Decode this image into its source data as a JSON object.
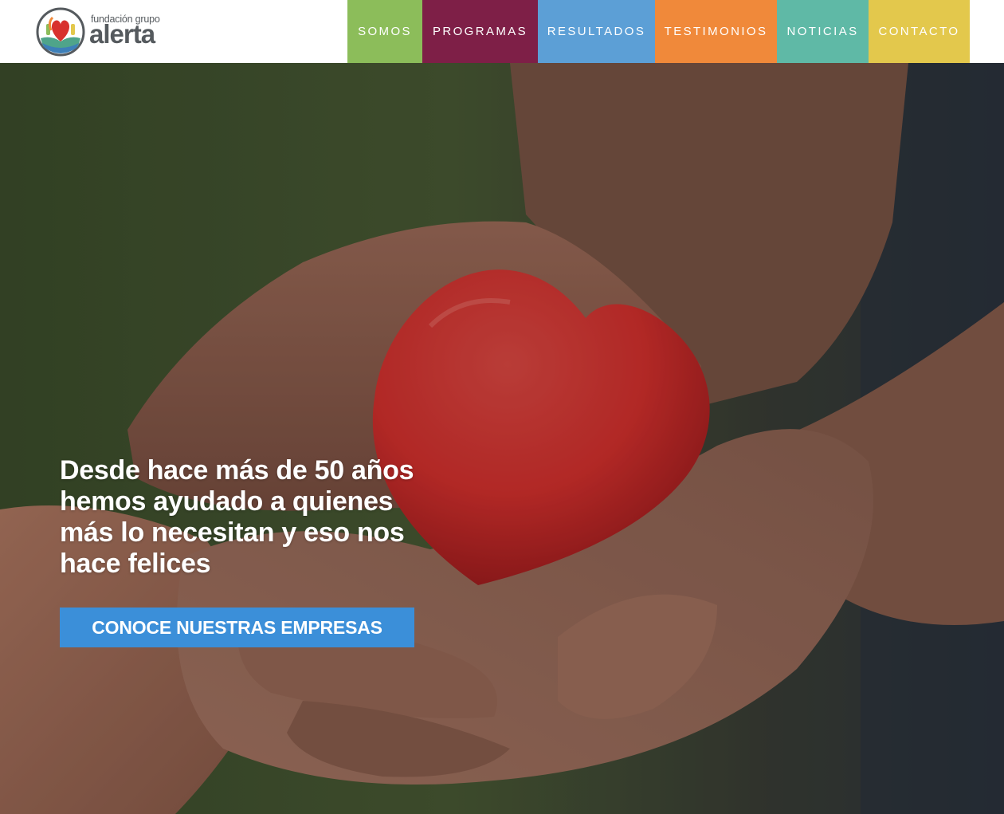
{
  "header": {
    "logo": {
      "line1": "fundación grupo",
      "line2": "alerta"
    },
    "nav": [
      {
        "label": "SOMOS",
        "color": "#8cbd5a"
      },
      {
        "label": "PROGRAMAS",
        "color": "#7e1f47"
      },
      {
        "label": "RESULTADOS",
        "color": "#5c9fd6"
      },
      {
        "label": "TESTIMONIOS",
        "color": "#f0893a"
      },
      {
        "label": "NOTICIAS",
        "color": "#5fb9a6"
      },
      {
        "label": "CONTACTO",
        "color": "#e3c84c"
      }
    ]
  },
  "hero": {
    "image": "hands-holding-red-heart-photo",
    "heading": "Desde hace más de 50 años hemos ayudado a quienes más lo necesitan y eso nos hace felices",
    "cta_label": "CONOCE NUESTRAS EMPRESAS",
    "cta_color": "#3b8fd9",
    "heart_color": "#d8312e"
  }
}
